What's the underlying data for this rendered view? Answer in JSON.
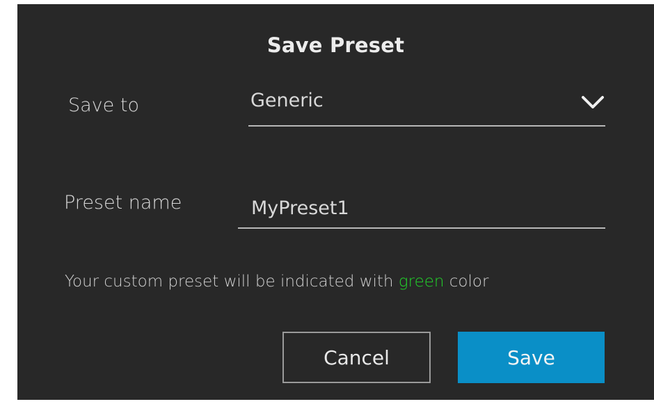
{
  "dialog": {
    "title": "Save Preset",
    "save_to": {
      "label": "Save to",
      "selected": "Generic",
      "dropdown_icon": "chevron-down-icon"
    },
    "preset_name": {
      "label": "Preset name",
      "value": "MyPreset1"
    },
    "hint": {
      "prefix": "Your custom preset will be indicated with ",
      "highlight": "green",
      "suffix": " color",
      "highlight_color": "#22d22a"
    },
    "buttons": {
      "cancel": "Cancel",
      "save": "Save"
    }
  },
  "colors": {
    "background": "#282828",
    "accent": "#0a8fc7",
    "text": "#d8d8d8"
  }
}
